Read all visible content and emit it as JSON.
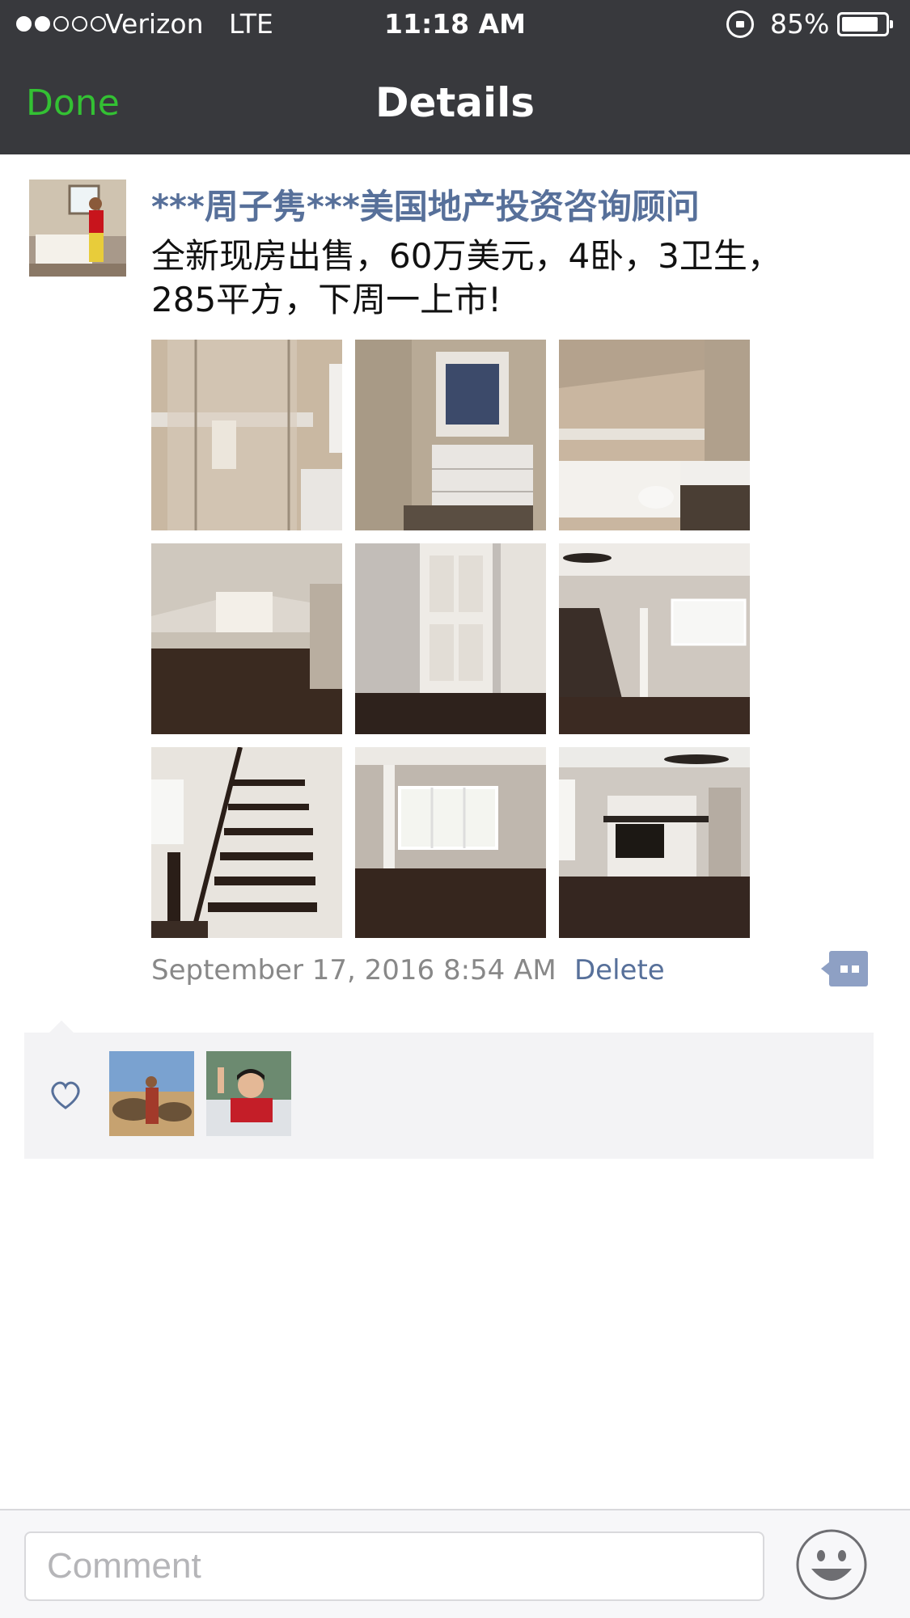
{
  "status_bar": {
    "carrier": "Verizon",
    "network": "LTE",
    "time": "11:18 AM",
    "battery_percent": "85%",
    "battery_level": 0.85,
    "signal_bars": 2
  },
  "nav": {
    "done_label": "Done",
    "title": "Details",
    "done_color": "#33c133"
  },
  "post": {
    "username": "***周子隽***美国地产投资咨询顾问",
    "text": "全新现房出售，60万美元，4卧，3卫生，285平方，下周一上市!",
    "photos": [
      {
        "subject": "glass shower"
      },
      {
        "subject": "bathroom vanity"
      },
      {
        "subject": "bathtub and toilet"
      },
      {
        "subject": "attic room with wood floor"
      },
      {
        "subject": "white interior doors"
      },
      {
        "subject": "living room with staircase"
      },
      {
        "subject": "staircase"
      },
      {
        "subject": "room with window and column"
      },
      {
        "subject": "fireplace and ceiling fan"
      }
    ],
    "timestamp": "September 17, 2016 8:54 AM",
    "delete_label": "Delete"
  },
  "likes": {
    "icon": "heart-icon",
    "likers": [
      {
        "subject": "person with camels in desert"
      },
      {
        "subject": "smiling woman waving"
      }
    ]
  },
  "comment_bar": {
    "placeholder": "Comment",
    "emoji_icon": "smiley-icon"
  },
  "colors": {
    "link_blue": "#57709a",
    "header_dark": "#38393d",
    "likes_bg": "#f3f3f5"
  }
}
